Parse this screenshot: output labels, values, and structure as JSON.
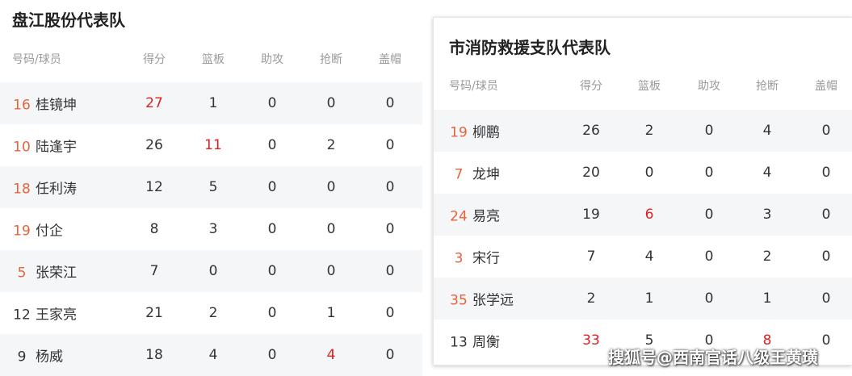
{
  "teams": [
    {
      "title": "盘江股份代表队",
      "headers": [
        "号码/球员",
        "得分",
        "篮板",
        "助攻",
        "抢断",
        "盖帽"
      ],
      "rows": [
        {
          "number": "16",
          "name": "桂镜坤",
          "stats": [
            "27",
            "1",
            "0",
            "0",
            "0"
          ],
          "highlight": [
            0
          ]
        },
        {
          "number": "10",
          "name": "陆逢宇",
          "stats": [
            "26",
            "11",
            "0",
            "2",
            "0"
          ],
          "highlight": [
            1
          ]
        },
        {
          "number": "18",
          "name": "任利涛",
          "stats": [
            "12",
            "5",
            "0",
            "0",
            "0"
          ],
          "highlight": []
        },
        {
          "number": "19",
          "name": "付企",
          "stats": [
            "8",
            "3",
            "0",
            "0",
            "0"
          ],
          "highlight": []
        },
        {
          "number": "5",
          "name": "张荣江",
          "stats": [
            "7",
            "0",
            "0",
            "0",
            "0"
          ],
          "highlight": []
        },
        {
          "number": "12",
          "name": "王家亮",
          "stats": [
            "21",
            "2",
            "0",
            "1",
            "0"
          ],
          "highlight": [],
          "plain_number": true
        },
        {
          "number": "9",
          "name": "杨威",
          "stats": [
            "18",
            "4",
            "0",
            "4",
            "0"
          ],
          "highlight": [
            3
          ],
          "plain_number": true
        }
      ]
    },
    {
      "title": "市消防救援支队代表队",
      "headers": [
        "号码/球员",
        "得分",
        "篮板",
        "助攻",
        "抢断",
        "盖帽"
      ],
      "rows": [
        {
          "number": "19",
          "name": "柳鹏",
          "stats": [
            "26",
            "2",
            "0",
            "4",
            "0"
          ],
          "highlight": []
        },
        {
          "number": "7",
          "name": "龙坤",
          "stats": [
            "20",
            "0",
            "0",
            "4",
            "0"
          ],
          "highlight": []
        },
        {
          "number": "24",
          "name": "易亮",
          "stats": [
            "19",
            "6",
            "0",
            "3",
            "0"
          ],
          "highlight": [
            1
          ]
        },
        {
          "number": "3",
          "name": "宋行",
          "stats": [
            "7",
            "4",
            "0",
            "2",
            "0"
          ],
          "highlight": []
        },
        {
          "number": "35",
          "name": "张学远",
          "stats": [
            "2",
            "1",
            "0",
            "1",
            "0"
          ],
          "highlight": []
        },
        {
          "number": "13",
          "name": "周衡",
          "stats": [
            "33",
            "5",
            "0",
            "8",
            "0"
          ],
          "highlight": [
            0,
            3
          ],
          "plain_number": true
        }
      ]
    }
  ],
  "watermark": "搜狐号@西南官话八级王黄璜",
  "colors": {
    "number": "#e8623a",
    "highlight": "#e02020",
    "header": "#9a9a9a",
    "row_alt": "#f5f6f8"
  }
}
